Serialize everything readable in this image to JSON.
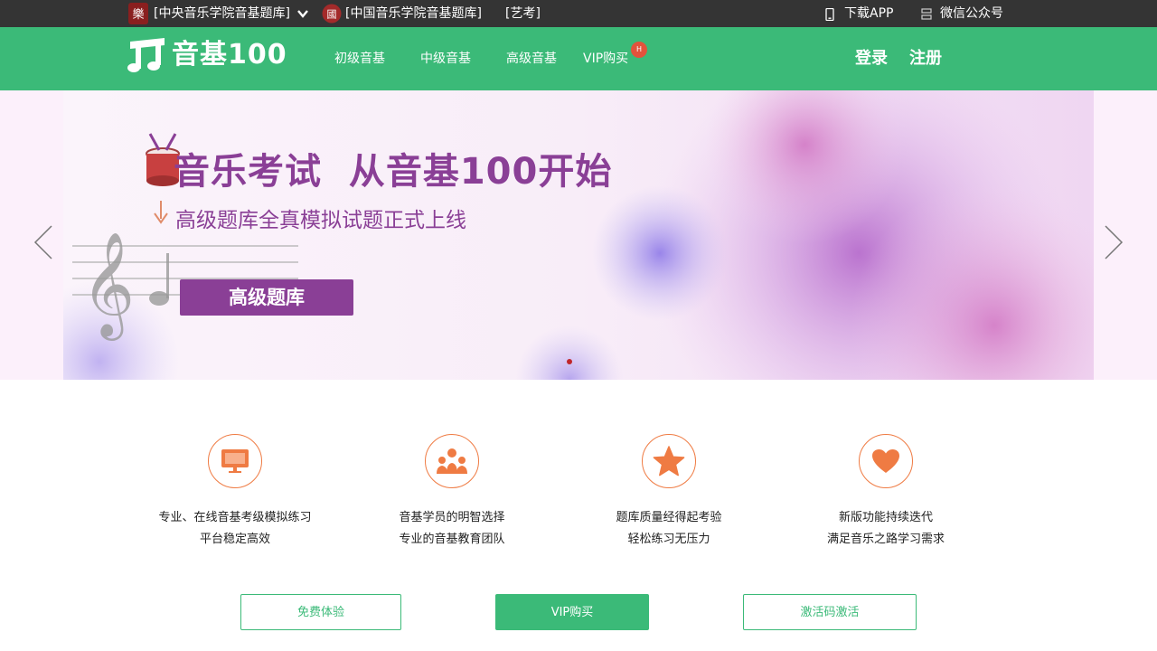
{
  "topbar": {
    "links": [
      {
        "label": "[中央音乐学院音基题库]"
      },
      {
        "label": "[中国音乐学院音基题库]"
      },
      {
        "label": "[艺考]"
      }
    ],
    "download_app": "下载APP",
    "wechat": "微信公众号"
  },
  "nav": {
    "logo_text": "音基100",
    "menu": [
      {
        "label": "初级音基"
      },
      {
        "label": "中级音基"
      },
      {
        "label": "高级音基"
      },
      {
        "label": "VIP购买"
      }
    ],
    "vip_badge": "H",
    "login": "登录",
    "register": "注册"
  },
  "banner": {
    "headline": "音乐考试  从音基100开始",
    "subline": "高级题库全真模拟试题正式上线",
    "button": "高级题库"
  },
  "features": [
    {
      "icon": "monitor-icon",
      "lines": [
        "专业、在线音基考级模拟练习",
        "平台稳定高效"
      ]
    },
    {
      "icon": "group-icon",
      "lines": [
        "音基学员的明智选择",
        "专业的音基教育团队"
      ]
    },
    {
      "icon": "star-icon",
      "lines": [
        "题库质量经得起考验",
        "轻松练习无压力"
      ]
    },
    {
      "icon": "heart-icon",
      "lines": [
        "新版功能持续迭代",
        "满足音乐之路学习需求"
      ]
    }
  ],
  "actions": {
    "free_trial": "免费体验",
    "vip_buy": "VIP购买",
    "activate": "激活码激活"
  },
  "colors": {
    "brand_green": "#3bba78",
    "topbar_bg": "#343434",
    "accent_orange": "#ef7b43",
    "banner_purple": "#8a3f96"
  }
}
